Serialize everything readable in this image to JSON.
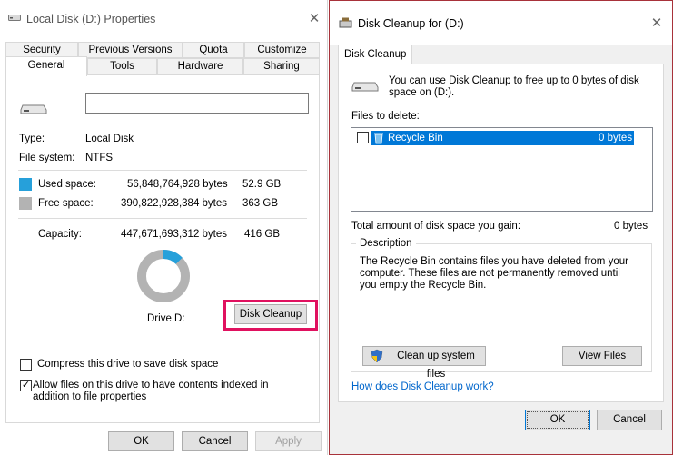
{
  "props": {
    "title": "Local Disk (D:) Properties",
    "tabs_row1": [
      "Security",
      "Previous Versions",
      "Quota",
      "Customize"
    ],
    "tabs_row2": [
      "General",
      "Tools",
      "Hardware",
      "Sharing"
    ],
    "type_label": "Type:",
    "type_value": "Local Disk",
    "fs_label": "File system:",
    "fs_value": "NTFS",
    "used_label": "Used space:",
    "used_bytes": "56,848,764,928 bytes",
    "used_gb": "52.9 GB",
    "free_label": "Free space:",
    "free_bytes": "390,822,928,384 bytes",
    "free_gb": "363 GB",
    "capacity_label": "Capacity:",
    "capacity_bytes": "447,671,693,312 bytes",
    "capacity_gb": "416 GB",
    "drive_label": "Drive D:",
    "disk_cleanup_button": "Disk Cleanup",
    "compress_label": "Compress this drive to save disk space",
    "index_label": "Allow files on this drive to have contents indexed in addition to file properties",
    "ok": "OK",
    "cancel": "Cancel",
    "apply": "Apply",
    "used_fraction": 0.127,
    "colors": {
      "used": "#26a0da",
      "free": "#b3b3b3",
      "highlight": "#e0115f"
    }
  },
  "cleanup": {
    "title": "Disk Cleanup for  (D:)",
    "tab": "Disk Cleanup",
    "intro": "You can use Disk Cleanup to free up to 0 bytes of disk space on  (D:).",
    "files_to_delete": "Files to delete:",
    "files": [
      {
        "name": "Recycle Bin",
        "size": "0 bytes",
        "checked": false
      }
    ],
    "total_label": "Total amount of disk space you gain:",
    "total_value": "0 bytes",
    "description_label": "Description",
    "description_text": "The Recycle Bin contains files you have deleted from your computer. These files are not permanently removed until you empty the Recycle Bin.",
    "clean_system_button": "Clean up system files",
    "view_files_button": "View Files",
    "help_link": "How does Disk Cleanup work?",
    "ok": "OK",
    "cancel": "Cancel",
    "colors": {
      "selection": "#0078d7",
      "link": "#0066cc",
      "border": "#a8323a"
    }
  }
}
